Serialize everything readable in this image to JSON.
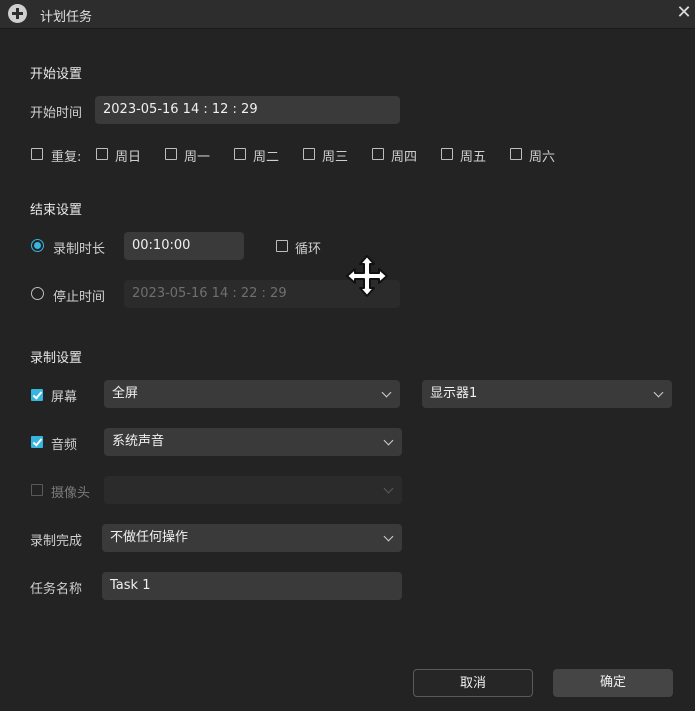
{
  "window": {
    "title": "计划任务"
  },
  "start": {
    "section_title": "开始设置",
    "time_label": "开始时间",
    "time_value": "2023-05-16 14 : 12 : 29",
    "repeat_label": "重复:",
    "days": [
      "周日",
      "周一",
      "周二",
      "周三",
      "周四",
      "周五",
      "周六"
    ]
  },
  "end": {
    "section_title": "结束设置",
    "duration_label": "录制时长",
    "duration_value": "00:10:00",
    "loop_label": "循环",
    "stop_label": "停止时间",
    "stop_value": "2023-05-16 14 : 22 : 29"
  },
  "record": {
    "section_title": "录制设置",
    "screen_label": "屏幕",
    "screen_value": "全屏",
    "display_value": "显示器1",
    "audio_label": "音频",
    "audio_value": "系统声音",
    "camera_label": "摄像头",
    "camera_value": "",
    "finish_label": "录制完成",
    "finish_value": "不做任何操作",
    "task_label": "任务名称",
    "task_value": "Task 1"
  },
  "buttons": {
    "cancel": "取消",
    "ok": "确定"
  },
  "colors": {
    "accent": "#35b5e0",
    "background": "#232323",
    "field": "#3a3a3a"
  }
}
